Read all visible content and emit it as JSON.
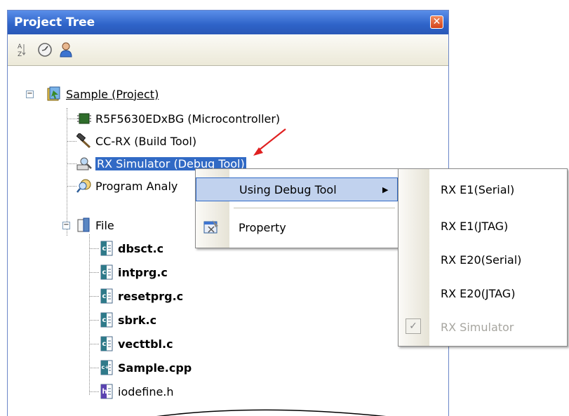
{
  "panel": {
    "title": "Project Tree",
    "close_glyph": "x"
  },
  "toolbar": {
    "icons": [
      "sort-az-icon",
      "build-clock-icon",
      "user-icon"
    ]
  },
  "tree": {
    "project": "Sample (Project)",
    "microcontroller": "R5F5630EDxBG (Microcontroller)",
    "build_tool": "CC-RX (Build Tool)",
    "debug_tool": "RX Simulator (Debug Tool)",
    "program_analyzer": "Program Analy",
    "file_folder": "File",
    "files": [
      "dbsct.c",
      "intprg.c",
      "resetprg.c",
      "sbrk.c",
      "vecttbl.c",
      "Sample.cpp",
      "iodefine.h"
    ]
  },
  "context_menu": {
    "using_debug_tool": "Using Debug Tool",
    "property": "Property"
  },
  "submenu": {
    "items": [
      "RX E1(Serial)",
      "RX E1(JTAG)",
      "RX E20(Serial)",
      "RX E20(JTAG)",
      "RX Simulator"
    ]
  },
  "colors": {
    "title_bar": "#2e63c8",
    "selection": "#316ac5",
    "annotation_arrow": "#e02020"
  }
}
